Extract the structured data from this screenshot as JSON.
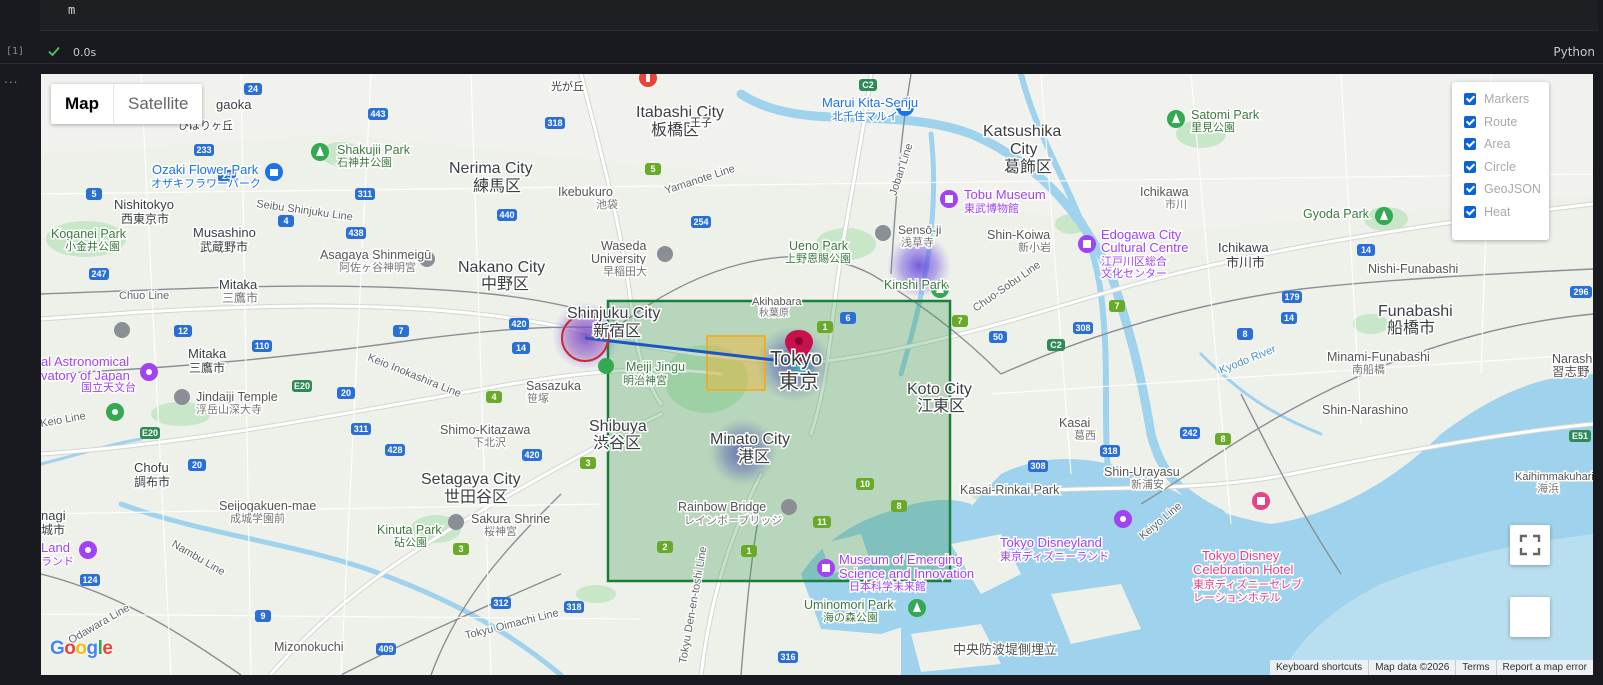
{
  "notebook": {
    "code": "m",
    "exec_count": "[1]",
    "status": {
      "icon": "check-icon",
      "time": "0.0s"
    },
    "language": "Python",
    "gutter": "..."
  },
  "map": {
    "map_type": {
      "map_label": "Map",
      "satellite_label": "Satellite",
      "selected": "Map"
    },
    "layers": [
      {
        "label": "Markers",
        "checked": true
      },
      {
        "label": "Route",
        "checked": true
      },
      {
        "label": "Area",
        "checked": true
      },
      {
        "label": "Circle",
        "checked": true
      },
      {
        "label": "GeoJSON",
        "checked": true
      },
      {
        "label": "Heat",
        "checked": true
      }
    ],
    "logo": "Google",
    "attribution": [
      "Keyboard shortcuts",
      "Map data ©2026",
      "Terms",
      "Report a map error"
    ],
    "places": {
      "itabashi": [
        "Itabashi City",
        "板橋区"
      ],
      "nerima": [
        "Nerima City",
        "練馬区"
      ],
      "nakano": [
        "Nakano City",
        "中野区"
      ],
      "shinjuku": [
        "Shinjuku City",
        "新宿区"
      ],
      "shibuya": [
        "Shibuya",
        "渋谷区"
      ],
      "setagaya": [
        "Setagaya City",
        "世田谷区"
      ],
      "minato": [
        "Minato City",
        "港区"
      ],
      "tokyo": [
        "Tokyo",
        "東京"
      ],
      "koto": [
        "Koto City",
        "江東区"
      ],
      "katsushika": [
        "Katsushika",
        "City",
        "葛飾区"
      ],
      "funabashi": [
        "Funabashi",
        "船橋市"
      ],
      "ichikawa": [
        "Ichikawa",
        "市川市"
      ],
      "nishitokyo": [
        "Nishitokyo",
        "西東京市"
      ],
      "musashino": [
        "Musashino",
        "武蔵野市"
      ],
      "mitaka": [
        "Mitaka",
        "三鷹市"
      ],
      "chofu": [
        "Chofu",
        "調布市"
      ],
      "tokyo_disney_celebration": [
        "Tokyo Disney",
        "Celebration Hotel",
        "東京ディズニーセレブ",
        "レーションホテル"
      ],
      "tokyo_disneyland": [
        "Tokyo Disneyland",
        "東京ディズニーランド"
      ],
      "edogawa": [
        "Edogawa City",
        "Cultural Centre",
        "江戸川区総合",
        "文化センター"
      ],
      "tobu_museum": [
        "Tobu Museum",
        "東武博物館"
      ],
      "museum_emerging": [
        "Museum of Emerging",
        "Science and Innovation",
        "日本科学未来館"
      ],
      "rainbow_bridge": [
        "Rainbow Bridge",
        "レインボーブリッジ"
      ],
      "meiji_jingu": [
        "Meiji Jingu",
        "明治神宮"
      ],
      "marui": [
        "Marui Kita-Senju",
        "北千住マルイ"
      ],
      "ozaki": [
        "Ozaki Flower Park",
        "オザキフラワーパーク"
      ],
      "shakujii": [
        "Shakujii Park",
        "石神井公園"
      ],
      "satomi": [
        "Satomi Park",
        "里見公園"
      ],
      "gyoda": [
        "Gyoda Park"
      ],
      "kinshi": [
        "Kinshi Park"
      ],
      "senso_ji": [
        "Sensō-ji",
        "浅草寺"
      ],
      "ueno": [
        "Ueno Park",
        "上野恩賜公園"
      ],
      "waseda": [
        "Waseda",
        "University",
        "早稲田大"
      ],
      "ikebukuro": [
        "Ikebukuro",
        "池袋"
      ],
      "asagaya": [
        "Asagaya Shinmeigū",
        "阿佐ヶ谷神明宮"
      ],
      "koganei": [
        "Koganei Park",
        "小金井公園"
      ],
      "jindaiji": [
        "Jindaiji Temple",
        "浮岳山深大寺"
      ],
      "kinuta": [
        "Kinuta Park",
        "砧公園"
      ],
      "sakura_shrine": [
        "Sakura Shrine",
        "桜神宮"
      ],
      "uminomori": [
        "Uminomori Park",
        "海の森公園"
      ],
      "kasai_rinkai": [
        "Kasai-Rinkai Park"
      ],
      "astro": [
        "al Astronomical",
        "vatory of Japan",
        "国立天文台"
      ],
      "shin_koiwa": [
        "Shin-Koiwa",
        "新小岩"
      ],
      "kasai": [
        "Kasai",
        "葛西"
      ],
      "shin_urayasu": [
        "Shin-Urayasu",
        "新浦安"
      ],
      "shin_narashino": [
        "Shin-Narashino"
      ],
      "minami_funabashi": [
        "Minami-Funabashi",
        "南船橋"
      ],
      "nishi_funabashi": [
        "Nishi-Funabashi"
      ],
      "narashi": [
        "Narashi",
        "習志野"
      ],
      "ichikawa_n": [
        "Ichikawa",
        "市川"
      ],
      "akihabara": [
        "Akihabara",
        "秋葉原"
      ],
      "sasazuka": [
        "Sasazuka",
        "笹塚"
      ],
      "shimo_kitazawa": [
        "Shimo-Kitazawa",
        "下北沢"
      ],
      "seijogakuen": [
        "Seijogakuen-mae",
        "成城学園前"
      ],
      "mizonokuchi": [
        "Mizonokuchi"
      ],
      "chuo_bofu": [
        "中央防波堤側埋立"
      ],
      "kaihimmakuhari": [
        "Kaihimmakuhari",
        "海浜"
      ],
      "land": [
        "Land",
        "ランド"
      ],
      "nagi": [
        "nagi",
        "城市"
      ],
      "gaoka": [
        "gaoka",
        "ひばりヶ丘"
      ],
      "kitaoji": [
        "王子"
      ],
      "hikarigaoka": [
        "光が丘"
      ]
    },
    "road_labels": [
      "Chuo Line",
      "Keio Line",
      "Seibu Shinjuku Line",
      "Keio Inokashira Line",
      "Yamanote Line",
      "Joban Line",
      "Chuo-Sobu Line",
      "Keiyo Line",
      "Nambu Line",
      "Tokyu Oimachi Line",
      "Tokyu Den-en-toshi Line",
      "Odawara Line",
      "Kyodo River"
    ],
    "road_shields": [
      "24",
      "443",
      "318",
      "233",
      "25",
      "5",
      "311",
      "440",
      "438",
      "4",
      "247",
      "12",
      "7",
      "110",
      "420",
      "14",
      "20",
      "E20",
      "428",
      "2",
      "10",
      "8",
      "1",
      "11",
      "3",
      "124",
      "9",
      "312",
      "409",
      "316",
      "308",
      "50",
      "C2",
      "179",
      "14",
      "E51",
      "296",
      "242",
      "7",
      "6",
      "8",
      "5",
      "254",
      "C2",
      "318",
      "E20",
      "20",
      "4",
      "3",
      "2",
      "1"
    ]
  },
  "overlays": {
    "rectangle_color": "#1a7f3a",
    "route_color": "#1a56c4",
    "circle_color": "#c8283c",
    "area_color": "#f2a818",
    "marker_color": "#c8104a",
    "heat_color": "#5a3cd8"
  }
}
